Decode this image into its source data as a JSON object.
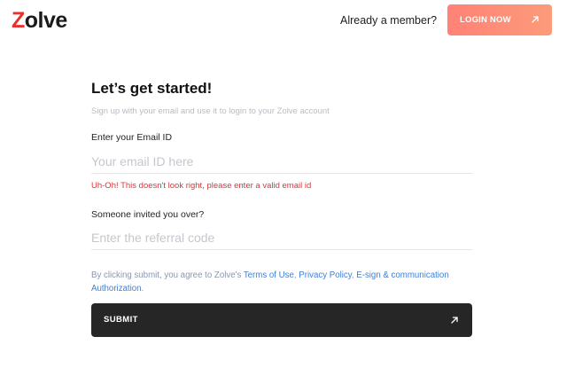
{
  "header": {
    "logo_first": "Z",
    "logo_rest": "olve",
    "already_member": "Already a member?",
    "login_label": "LOGIN NOW",
    "login_icon": "arrow-up-right-icon"
  },
  "form": {
    "title": "Let’s get started!",
    "subtitle": "Sign up with your email and use it to login to your Zolve account",
    "email_label": "Enter your Email ID",
    "email_placeholder": "Your email ID here",
    "email_value": "",
    "email_error": "Uh-Oh! This doesn't look right, please enter a valid email id",
    "referral_label": "Someone invited you over?",
    "referral_placeholder": "Enter the referral code",
    "referral_value": "",
    "terms_prefix": "By clicking submit, you agree to Zolve's ",
    "terms_link": "Terms of Use",
    "terms_sep": ", ",
    "privacy_link": "Privacy Policy",
    "terms_sep2": ", ",
    "esign_link": "E-sign & communication Authorization",
    "terms_suffix": ".",
    "submit_label": "SUBMIT",
    "submit_icon": "arrow-up-right-icon"
  },
  "colors": {
    "brand_red": "#e8302c",
    "login_gradient_start": "#ff8276",
    "login_gradient_end": "#fb9b7a",
    "error": "#e0323a",
    "link": "#3f7fd8",
    "submit_bg": "#262626"
  }
}
